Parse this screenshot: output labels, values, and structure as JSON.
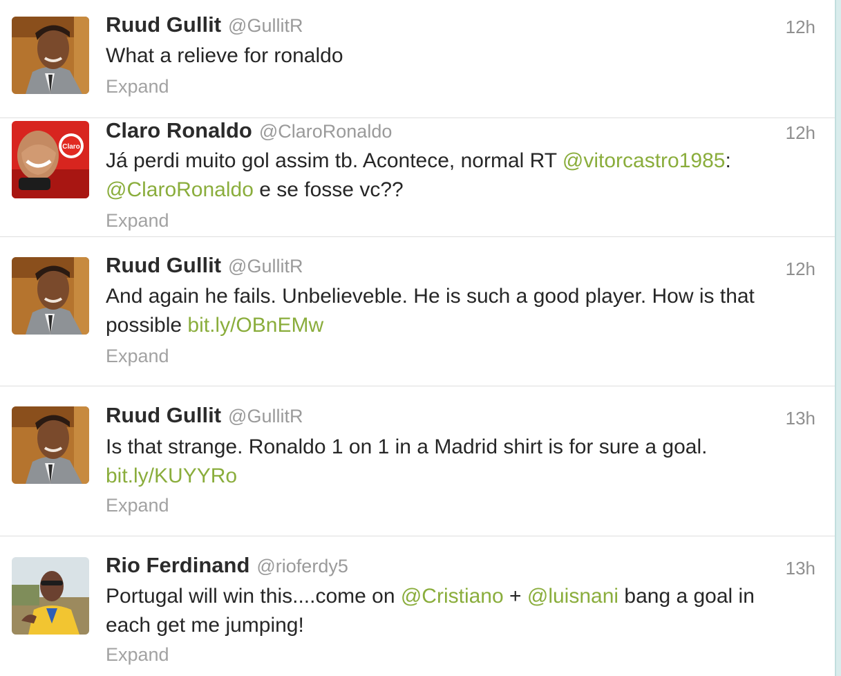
{
  "tweets": [
    {
      "name": "Ruud Gullit",
      "handle": "@GullitR",
      "time": "12h",
      "line1": [
        {
          "t": "What a relieve for ronaldo",
          "link": false
        }
      ],
      "line2": [],
      "expand": "Expand",
      "avatar": "ruud-gullit-avatar"
    },
    {
      "name": "Claro Ronaldo",
      "handle": "@ClaroRonaldo",
      "time": "12h",
      "line1": [
        {
          "t": "Já perdi muito gol assim tb. Acontece, normal RT ",
          "link": false
        },
        {
          "t": "@vitorcastro1985",
          "link": true
        },
        {
          "t": ":",
          "link": false
        }
      ],
      "line2": [
        {
          "t": "@ClaroRonaldo",
          "link": true
        },
        {
          "t": " e se fosse vc??",
          "link": false
        }
      ],
      "expand": "Expand",
      "avatar": "claro-ronaldo-avatar",
      "avatar_badge": "Claro"
    },
    {
      "name": "Ruud Gullit",
      "handle": "@GullitR",
      "time": "12h",
      "line1": [
        {
          "t": "And again he fails. Unbelieveble. He is such a good player. How is that",
          "link": false
        }
      ],
      "line2": [
        {
          "t": "possible ",
          "link": false
        },
        {
          "t": "bit.ly/OBnEMw",
          "link": true
        }
      ],
      "expand": "Expand",
      "avatar": "ruud-gullit-avatar"
    },
    {
      "name": "Ruud Gullit",
      "handle": "@GullitR",
      "time": "13h",
      "line1": [
        {
          "t": "Is that strange. Ronaldo 1 on 1 in a Madrid shirt is for sure a goal.",
          "link": false
        }
      ],
      "line2": [
        {
          "t": "bit.ly/KUYYRo",
          "link": true
        }
      ],
      "expand": "Expand",
      "avatar": "ruud-gullit-avatar"
    },
    {
      "name": "Rio Ferdinand",
      "handle": "@rioferdy5",
      "time": "13h",
      "line1": [
        {
          "t": "Portugal will win this....come on ",
          "link": false
        },
        {
          "t": "@Cristiano",
          "link": true
        },
        {
          "t": " + ",
          "link": false
        },
        {
          "t": "@luisnani",
          "link": true
        },
        {
          "t": " bang a goal in",
          "link": false
        }
      ],
      "line2": [
        {
          "t": "each get me jumping!",
          "link": false
        }
      ],
      "expand": "Expand",
      "avatar": "rio-ferdinand-avatar"
    }
  ],
  "colors": {
    "link": "#8aad3c",
    "name": "#2b2b2b",
    "meta": "#9a9a9a"
  }
}
